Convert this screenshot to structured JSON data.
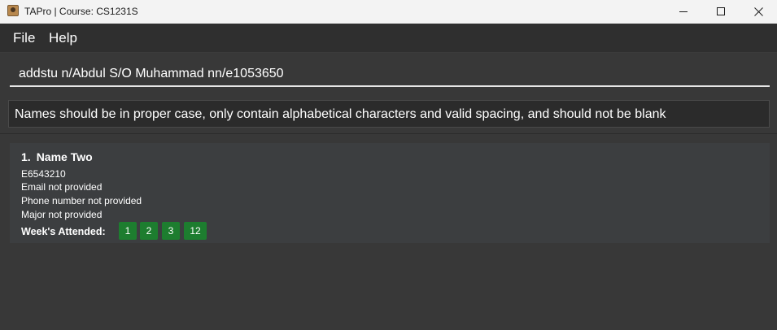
{
  "window": {
    "title": "TAPro | Course: CS1231S"
  },
  "menu": {
    "items": [
      {
        "label": "File"
      },
      {
        "label": "Help"
      }
    ]
  },
  "command": {
    "value": "addstu n/Abdul S/O Muhammad nn/e1053650"
  },
  "result": {
    "message": "Names should be in proper case, only contain alphabetical characters and valid spacing, and should not be blank"
  },
  "students": [
    {
      "index": "1.",
      "name": "Name Two",
      "nusnet": "E6543210",
      "email": "Email not provided",
      "phone": "Phone number not provided",
      "major": "Major not provided",
      "weeks_label": "Week's Attended:",
      "weeks": [
        "1",
        "2",
        "3",
        "12"
      ]
    }
  ],
  "colors": {
    "background": "#383838",
    "menubar": "#2f2f2f",
    "titlebar": "#f3f3f3",
    "card": "#3c3e40",
    "tag": "#1d7d2f",
    "text": "#ffffff"
  },
  "icons": {
    "app": "app-icon",
    "minimize": "minimize-icon",
    "maximize": "maximize-icon",
    "close": "close-icon"
  }
}
